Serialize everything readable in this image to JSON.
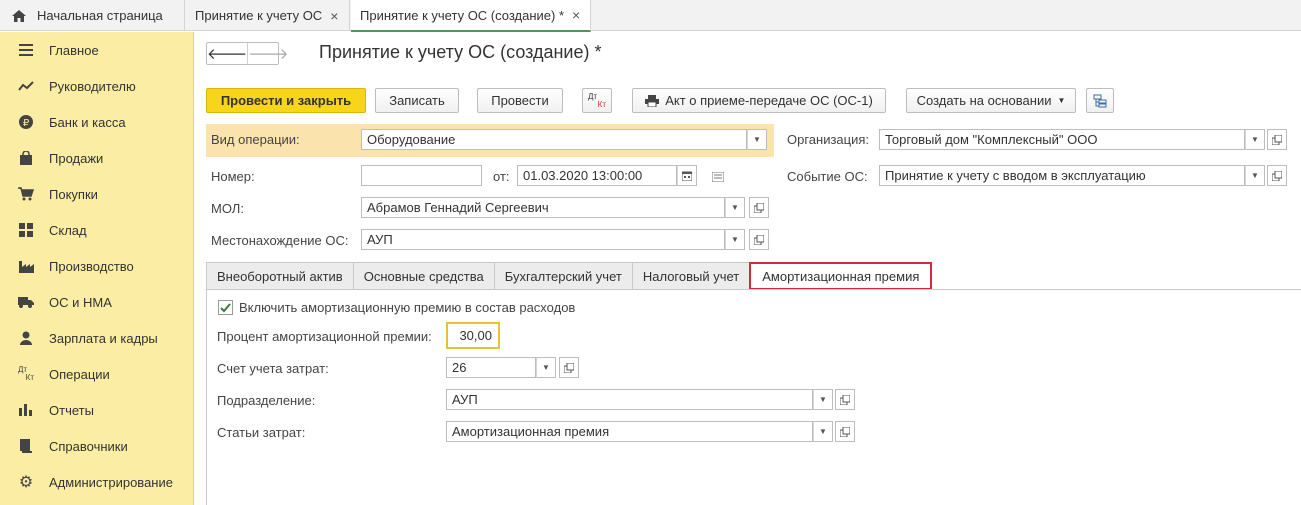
{
  "window_tabs": [
    {
      "label": "Начальная страница"
    },
    {
      "label": "Принятие к учету ОС"
    },
    {
      "label": "Принятие к учету ОС (создание) *"
    }
  ],
  "sidebar": {
    "items": [
      {
        "label": "Главное",
        "icon": "menu-icon"
      },
      {
        "label": "Руководителю",
        "icon": "chart-trend-icon"
      },
      {
        "label": "Банк и касса",
        "icon": "ruble-coin-icon"
      },
      {
        "label": "Продажи",
        "icon": "shopping-bag-icon"
      },
      {
        "label": "Покупки",
        "icon": "cart-icon"
      },
      {
        "label": "Склад",
        "icon": "warehouse-grid-icon"
      },
      {
        "label": "Производство",
        "icon": "factory-icon"
      },
      {
        "label": "ОС и НМА",
        "icon": "truck-icon"
      },
      {
        "label": "Зарплата и кадры",
        "icon": "person-icon"
      },
      {
        "label": "Операции",
        "icon": "dt-kt-icon"
      },
      {
        "label": "Отчеты",
        "icon": "bar-chart-icon"
      },
      {
        "label": "Справочники",
        "icon": "book-icon"
      },
      {
        "label": "Администрирование",
        "icon": "gear-icon"
      }
    ]
  },
  "form": {
    "title": "Принятие к учету ОС (создание) *",
    "toolbar": {
      "post_close": "Провести и закрыть",
      "save": "Записать",
      "post": "Провести",
      "dtkt_top": "Дт",
      "dtkt_bottom": "Кт",
      "print_act": "Акт о приеме-передаче ОС (ОС-1)",
      "create_based": "Создать на основании"
    },
    "header": {
      "op_type_label": "Вид операции:",
      "op_type_value": "Оборудование",
      "org_label": "Организация:",
      "org_value": "Торговый дом \"Комплексный\" ООО",
      "number_label": "Номер:",
      "number_value": "",
      "date_label": "от:",
      "date_value": "01.03.2020 13:00:00",
      "event_label": "Событие ОС:",
      "event_value": "Принятие к учету с вводом в эксплуатацию",
      "mol_label": "МОЛ:",
      "mol_value": "Абрамов Геннадий Сергеевич",
      "location_label": "Местонахождение ОС:",
      "location_value": "АУП"
    },
    "tabs": [
      {
        "label": "Внеоборотный актив"
      },
      {
        "label": "Основные средства"
      },
      {
        "label": "Бухгалтерский учет"
      },
      {
        "label": "Налоговый учет"
      },
      {
        "label": "Амортизационная премия"
      }
    ],
    "bonus": {
      "include_label": "Включить амортизационную премию в состав расходов",
      "include_checked": true,
      "percent_label": "Процент амортизационной премии:",
      "percent_value": "30,00",
      "account_label": "Счет учета затрат:",
      "account_value": "26",
      "division_label": "Подразделение:",
      "division_value": "АУП",
      "cost_item_label": "Статьи затрат:",
      "cost_item_value": "Амортизационная премия"
    }
  },
  "colors": {
    "sidebar_bg": "#fbeea4",
    "primary_button": "#f7d51a",
    "active_tab_border": "#cc2f3a",
    "highlight_row": "#fbe3ae",
    "focus_field_border": "#e8c13a"
  }
}
